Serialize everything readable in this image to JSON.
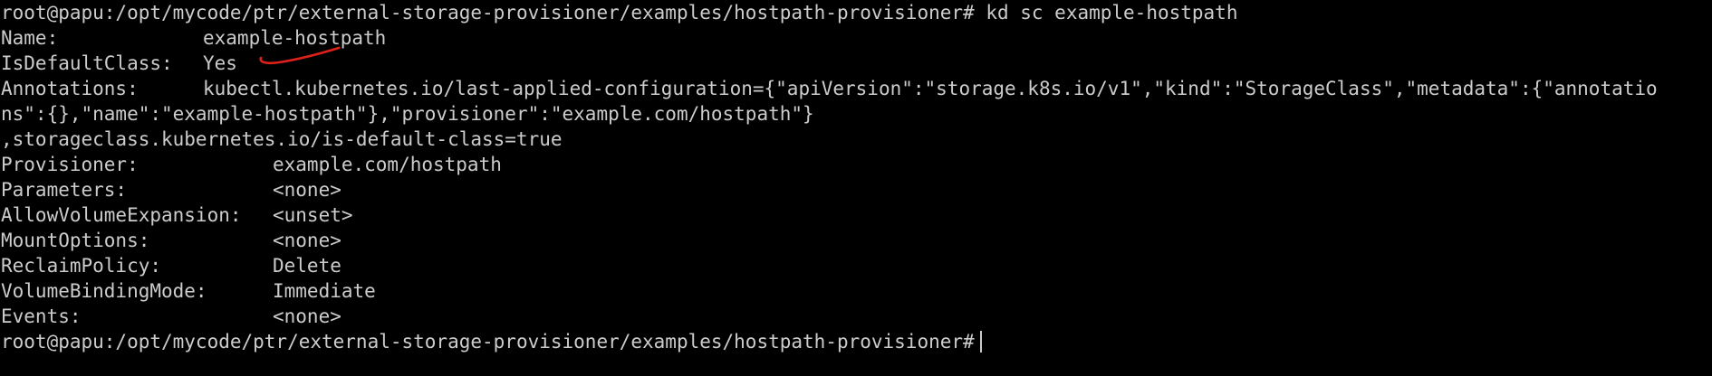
{
  "terminal": {
    "lines": [
      {
        "type": "prompt",
        "prompt": "root@papu:/opt/mycode/ptr/external-storage-provisioner/examples/hostpath-provisioner#",
        "command": " kd sc example-hostpath"
      },
      {
        "type": "kv14",
        "key": "Name:",
        "value": "example-hostpath"
      },
      {
        "type": "kv14",
        "key": "IsDefaultClass:",
        "value": "Yes"
      },
      {
        "type": "kv14",
        "key": "Annotations:",
        "value": "kubectl.kubernetes.io/last-applied-configuration={\"apiVersion\":\"storage.k8s.io/v1\",\"kind\":\"StorageClass\",\"metadata\":{\"annotatio"
      },
      {
        "type": "text",
        "text": "ns\":{},\"name\":\"example-hostpath\"},\"provisioner\":\"example.com/hostpath\"}"
      },
      {
        "type": "text",
        "text": ",storageclass.kubernetes.io/is-default-class=true"
      },
      {
        "type": "kv21",
        "key": "Provisioner:",
        "value": "example.com/hostpath"
      },
      {
        "type": "kv21",
        "key": "Parameters:",
        "value": "<none>"
      },
      {
        "type": "kv21",
        "key": "AllowVolumeExpansion:",
        "value": "<unset>"
      },
      {
        "type": "kv21",
        "key": "MountOptions:",
        "value": "<none>"
      },
      {
        "type": "kv21",
        "key": "ReclaimPolicy:",
        "value": "Delete"
      },
      {
        "type": "kv21",
        "key": "VolumeBindingMode:",
        "value": "Immediate"
      },
      {
        "type": "kv21",
        "key": "Events:",
        "value": "<none>"
      },
      {
        "type": "prompt",
        "prompt": "root@papu:/opt/mycode/ptr/external-storage-provisioner/examples/hostpath-provisioner#",
        "command": ""
      }
    ]
  },
  "colors": {
    "background": "#000000",
    "foreground": "#cccccc",
    "annotation_mark": "#e0201a"
  }
}
